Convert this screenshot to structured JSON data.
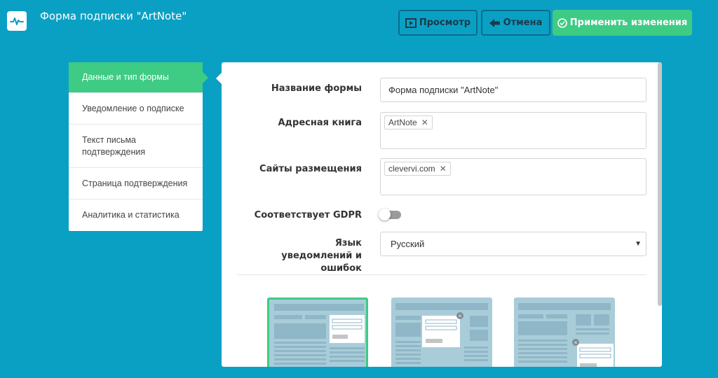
{
  "header": {
    "title": "Форма подписки \"ArtNote\"",
    "preview_label": "Просмотр",
    "cancel_label": "Отмена",
    "apply_label": "Применить изменения"
  },
  "sidebar": {
    "items": [
      {
        "label": "Данные и тип формы",
        "active": true
      },
      {
        "label": "Уведомление о подписке",
        "active": false
      },
      {
        "label": "Текст письма подтверждения",
        "active": false
      },
      {
        "label": "Страница подтверждения",
        "active": false
      },
      {
        "label": "Аналитика и статистика",
        "active": false
      }
    ]
  },
  "form": {
    "name_label": "Название формы",
    "name_value": "Форма подписки \"ArtNote\"",
    "addressbook_label": "Адресная книга",
    "addressbook_tags": [
      "ArtNote"
    ],
    "sites_label": "Сайты размещения",
    "sites_tags": [
      "clevervi.com"
    ],
    "gdpr_label": "Соответствует GDPR",
    "gdpr_enabled": false,
    "language_label": "Язык уведомлений и ошибок",
    "language_value": "Русский"
  },
  "form_types": [
    {
      "name": "embedded",
      "selected": true
    },
    {
      "name": "popup",
      "selected": false
    },
    {
      "name": "corner-popup",
      "selected": false
    }
  ],
  "colors": {
    "background": "#0aa0c4",
    "accent_green": "#3ecb84",
    "button_border": "#0b6c8c",
    "thumb_bg": "#a9ccd9"
  }
}
